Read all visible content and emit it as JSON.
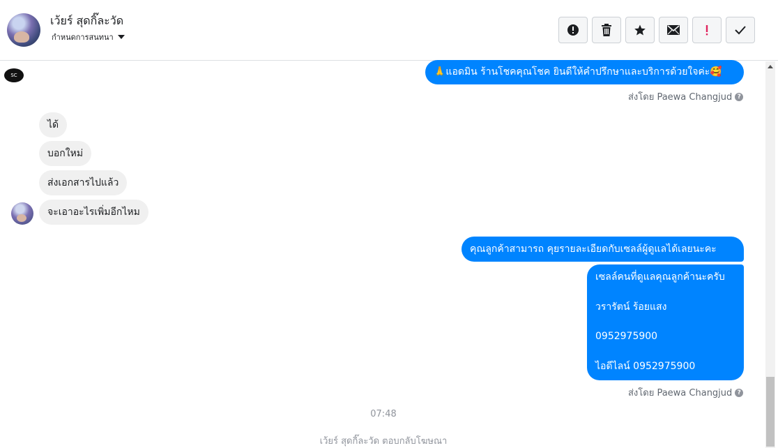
{
  "header": {
    "contact_name": "เว้ยร์ สุดกิ๊ละวัด",
    "assign_label": "กำหนดการสนทนา",
    "actions": [
      {
        "name": "mark-spam-button",
        "icon": "alert-circle-icon"
      },
      {
        "name": "delete-button",
        "icon": "trash-icon"
      },
      {
        "name": "star-button",
        "icon": "star-icon"
      },
      {
        "name": "mark-unread-button",
        "icon": "envelope-icon"
      },
      {
        "name": "priority-button",
        "icon": "exclamation-icon"
      },
      {
        "name": "mark-done-button",
        "icon": "check-icon"
      }
    ]
  },
  "messages": {
    "outgoing_1": "🙏แอดมิน ร้านโชคคุณโชค ยินดีให้คำปรึกษาและบริการด้วยใจค่ะ🥰",
    "sent_by_1": "ส่งโดย Paewa Changjud",
    "incoming": [
      "ได้",
      "บอกใหม่",
      "ส่งเอกสารไปแล้ว",
      "จะเอาอะไรเพิ่มอีกไหม"
    ],
    "outgoing_2": "คุณลูกค้าสามารถ คุยรายละเอียดกับเซลล์ผู้ดูแลได้เลยนะคะ",
    "outgoing_3_lines": [
      "เซลล์คนที่ดูแลคุณลูกค้านะครับ",
      "วรารัตน์ ร้อยแสง",
      "0952975900",
      "ไอดีไลน์ 0952975900"
    ],
    "sent_by_2": "ส่งโดย Paewa Changjud",
    "time": "07:48",
    "footer": "เว้ยร์ สุดกิ๊ละวัด ตอบกลับโฆษณา"
  },
  "page_icon_label": "SC",
  "colors": {
    "accent": "#0084ff",
    "incoming_bg": "#f0f0f0",
    "muted": "#606770"
  }
}
